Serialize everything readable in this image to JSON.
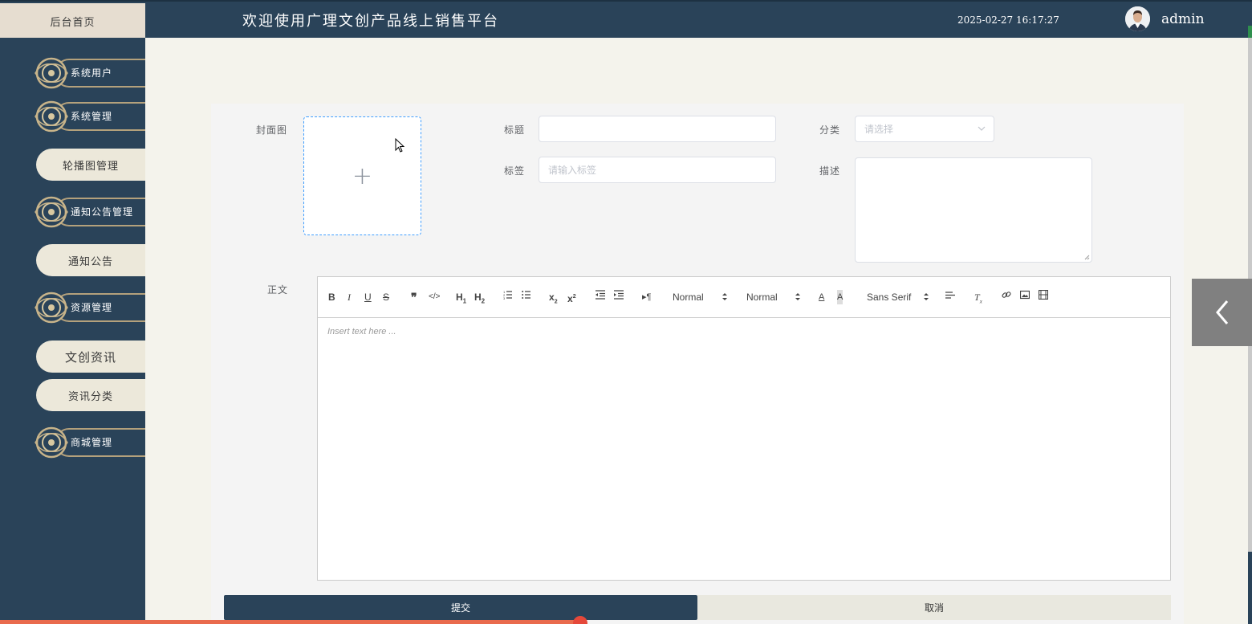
{
  "header": {
    "home_tab": "后台首页",
    "title": "欢迎使用广理文创产品线上销售平台",
    "datetime": "2025-02-27 16:17:27",
    "username": "admin",
    "avatar_icon": "user-avatar"
  },
  "sidebar": {
    "items": [
      {
        "label": "系统用户",
        "type": "main"
      },
      {
        "label": "系统管理",
        "type": "main"
      },
      {
        "label": "轮播图管理",
        "type": "sub"
      },
      {
        "label": "通知公告管理",
        "type": "main"
      },
      {
        "label": "通知公告",
        "type": "sub"
      },
      {
        "label": "资源管理",
        "type": "main"
      },
      {
        "label": "文创资讯",
        "type": "sub"
      },
      {
        "label": "资讯分类",
        "type": "sub"
      },
      {
        "label": "商城管理",
        "type": "main"
      }
    ]
  },
  "form": {
    "cover_label": "封面图",
    "title_label": "标题",
    "title_value": "",
    "category_label": "分类",
    "category_placeholder": "请选择",
    "tags_label": "标签",
    "tags_placeholder": "请输入标签",
    "desc_label": "描述",
    "body_label": "正文"
  },
  "editor": {
    "header_picker": "Normal",
    "size_picker": "Normal",
    "font_picker": "Sans Serif",
    "placeholder": "Insert text here ..."
  },
  "buttons": {
    "submit": "提交",
    "cancel": "取消"
  },
  "colors": {
    "primary": "#2a4359",
    "accent_gold": "#b4a17c",
    "upload_border": "#409eff"
  }
}
